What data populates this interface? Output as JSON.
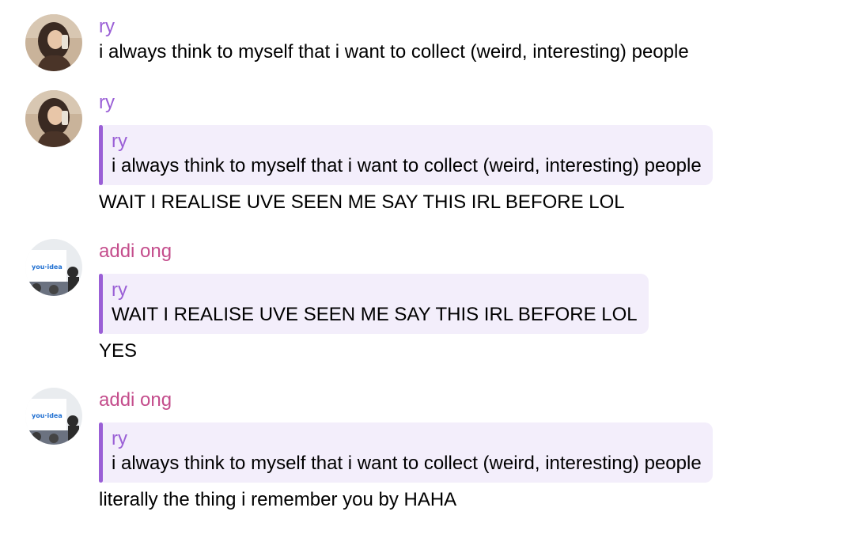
{
  "colors": {
    "ry_name": "#9a5fd6",
    "addi_name": "#c44d8c",
    "quote_bg": "#f3eefb",
    "quote_bar": "#9a5fd6"
  },
  "messages": [
    {
      "sender": "ry",
      "text": "i always think to myself that i want to collect (weird, interesting) people"
    },
    {
      "sender": "ry",
      "quote": {
        "sender": "ry",
        "text": "i always think to myself that i want to collect (weird, interesting) people"
      },
      "text": "WAIT I REALISE UVE SEEN ME SAY THIS IRL BEFORE LOL"
    },
    {
      "sender": "addi ong",
      "avatar_text": "you·idea",
      "quote": {
        "sender": "ry",
        "text": "WAIT I REALISE UVE SEEN ME SAY THIS IRL BEFORE LOL"
      },
      "text": "YES"
    },
    {
      "sender": "addi ong",
      "avatar_text": "you·idea",
      "quote": {
        "sender": "ry",
        "text": "i always think to myself that i want to collect (weird, interesting) people"
      },
      "text": "literally the thing i remember you by HAHA"
    }
  ]
}
